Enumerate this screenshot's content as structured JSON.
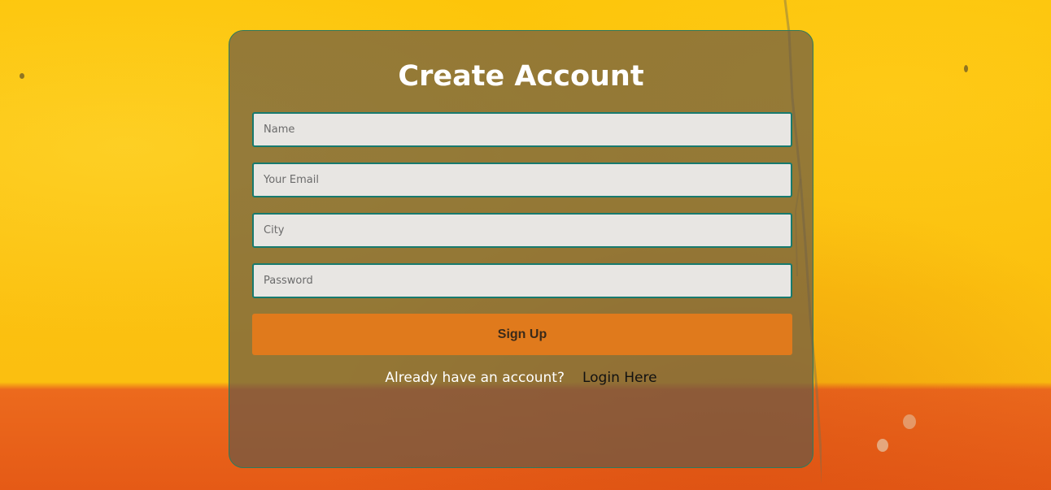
{
  "form": {
    "title": "Create Account",
    "fields": [
      {
        "placeholder": "Name",
        "value": ""
      },
      {
        "placeholder": "Your Email",
        "value": ""
      },
      {
        "placeholder": "City",
        "value": ""
      },
      {
        "placeholder": "Password",
        "value": ""
      }
    ],
    "submit_label": "Sign Up",
    "login_prompt": "Already have an account?",
    "login_link": "Login Here"
  },
  "colors": {
    "wall_top": "#fdc50a",
    "wall_bottom": "#e55a16",
    "card_overlay": "#685846",
    "field_border": "#177a6e",
    "field_bg": "#e8e6e3",
    "button_bg": "#e07a1c"
  }
}
